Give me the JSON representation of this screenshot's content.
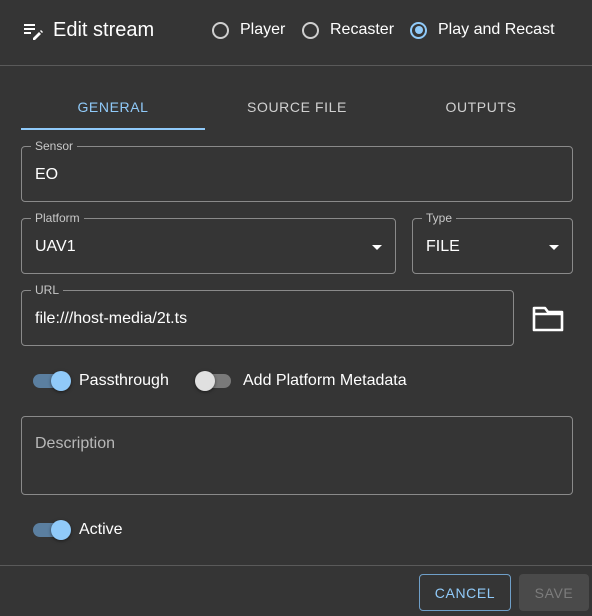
{
  "header": {
    "title": "Edit stream",
    "icon": "edit-list-icon",
    "modes": [
      {
        "label": "Player",
        "checked": false
      },
      {
        "label": "Recaster",
        "checked": false
      },
      {
        "label": "Play and Recast",
        "checked": true
      }
    ]
  },
  "tabs": [
    {
      "label": "GENERAL",
      "active": true
    },
    {
      "label": "SOURCE FILE",
      "active": false
    },
    {
      "label": "OUTPUTS",
      "active": false
    }
  ],
  "form": {
    "sensor": {
      "label": "Sensor",
      "value": "EO"
    },
    "platform": {
      "label": "Platform",
      "value": "UAV1"
    },
    "type": {
      "label": "Type",
      "value": "FILE"
    },
    "url": {
      "label": "URL",
      "value": "file:///host-media/2t.ts"
    },
    "folder_icon": "folder-icon",
    "passthrough": {
      "label": "Passthrough",
      "on": true
    },
    "add_platform_metadata": {
      "label": "Add Platform Metadata",
      "on": false
    },
    "description": {
      "placeholder": "Description",
      "value": ""
    },
    "active": {
      "label": "Active",
      "on": true
    }
  },
  "footer": {
    "cancel_label": "CANCEL",
    "save_label": "SAVE"
  },
  "colors": {
    "background": "#353535",
    "accent": "#90caf9",
    "border": "#8a8a8a"
  }
}
